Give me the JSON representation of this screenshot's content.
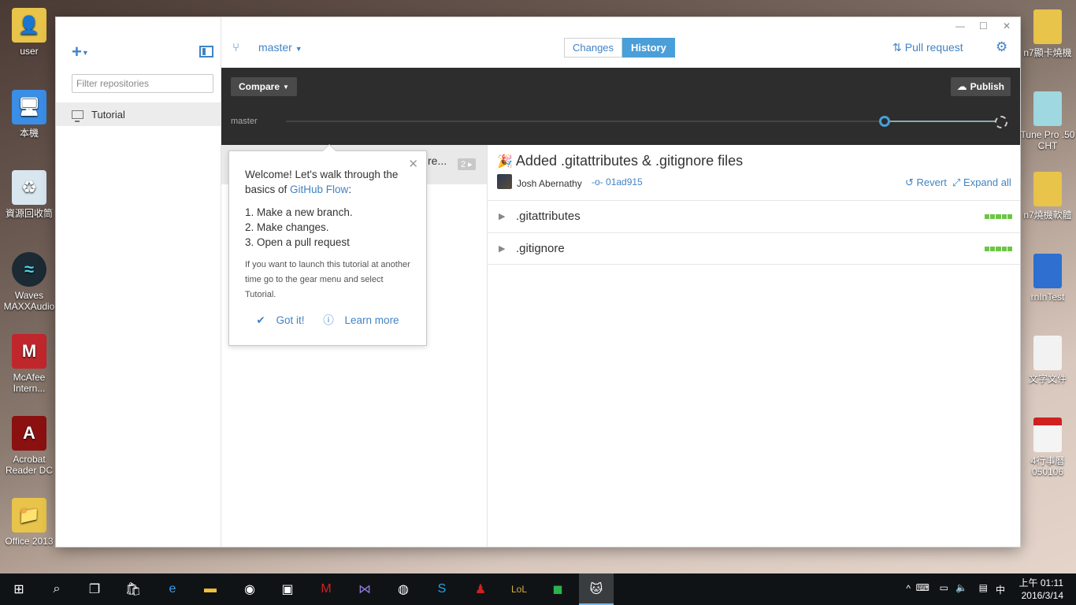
{
  "desktop": {
    "left_icons": [
      {
        "label": "user"
      },
      {
        "label": "本機"
      },
      {
        "label": "資源回收筒"
      },
      {
        "label": "Waves MAXXAudio"
      },
      {
        "label": "McAfee Intern..."
      },
      {
        "label": "Acrobat Reader DC"
      },
      {
        "label": "Office 2013"
      }
    ],
    "right_icons": [
      {
        "label": "n7顯卡燒機"
      },
      {
        "label": "Tune Pro .50 CHT"
      },
      {
        "label": "n7燒機軟體"
      },
      {
        "label": "rnInTest"
      },
      {
        "label": "文字文件"
      },
      {
        "label": "4行事曆 050106"
      }
    ]
  },
  "sidebar": {
    "filter_placeholder": "Filter repositories",
    "repos": [
      {
        "label": "Tutorial"
      }
    ]
  },
  "topbar": {
    "branch": "master",
    "tabs": [
      {
        "label": "Changes"
      },
      {
        "label": "History"
      }
    ],
    "pull_request": "Pull request",
    "window_controls": [
      "—",
      "☐",
      "✕"
    ]
  },
  "toolbar": {
    "compare": "Compare",
    "publish": "Publish",
    "timeline_label": "master"
  },
  "commit_list": {
    "truncated_text": "re...",
    "badge": "2 ▸"
  },
  "commit": {
    "title": "Added .gitattributes & .gitignore files",
    "author": "Josh Abernathy",
    "sha": "01ad915",
    "revert": "Revert",
    "expand_all": "Expand all",
    "files": [
      {
        "name": ".gitattributes"
      },
      {
        "name": ".gitignore"
      }
    ]
  },
  "popover": {
    "intro_1": "Welcome! Let's walk through the basics of ",
    "intro_link": "GitHub Flow",
    "intro_2": ":",
    "steps": [
      "1. Make a new branch.",
      "2. Make changes.",
      "3. Open a pull request"
    ],
    "note": "If you want to launch this tutorial at another time go to the gear menu and select Tutorial.",
    "got_it": "Got it!",
    "learn_more": "Learn more"
  },
  "taskbar": {
    "time": "上午 01:11",
    "date": "2016/3/14",
    "ime": "中"
  }
}
